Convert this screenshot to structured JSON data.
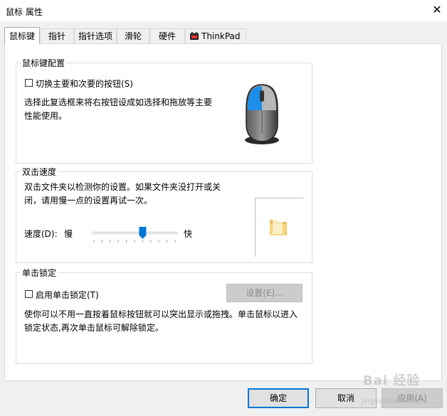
{
  "window": {
    "title": "鼠标 属性",
    "close_glyph": "✕"
  },
  "tabs": [
    {
      "label": "鼠标键",
      "active": true
    },
    {
      "label": "指针"
    },
    {
      "label": "指针选项"
    },
    {
      "label": "滑轮"
    },
    {
      "label": "硬件"
    },
    {
      "label": "ThinkPad"
    }
  ],
  "buttons_group": {
    "title": "鼠标键配置",
    "switch_checkbox_label": "切换主要和次要的按钮(S)",
    "switch_checked": false,
    "description": "选择此复选框来将右按钮设成如选择和拖放等主要性能使用。"
  },
  "double_click": {
    "title": "双击速度",
    "description": "双击文件夹以检测你的设置。如果文件夹没打开或关闭，请用慢一点的设置再试一次。",
    "speed_label": "速度(D):",
    "slow_label": "慢",
    "fast_label": "快",
    "speed_fraction": 0.6
  },
  "click_lock": {
    "title": "单击锁定",
    "checkbox_label": "启用单击锁定(T)",
    "checked": false,
    "settings_button": "设置(E)...",
    "description": "使你可以不用一直按着鼠标按钮就可以突出显示或拖拽。单击鼠标以进入锁定状态,再次单击鼠标可解除锁定。"
  },
  "footer": {
    "ok": "确定",
    "cancel": "取消",
    "apply": "应用(A)"
  },
  "watermark": {
    "main": "Bai 经验",
    "sub": "jingyan.baidu.com"
  },
  "colors": {
    "accent": "#0078d7",
    "mouse_highlight": "#1e8fe8"
  },
  "icons": [
    "close-icon",
    "thinkpad-icon",
    "mouse-icon",
    "folder-icon"
  ]
}
